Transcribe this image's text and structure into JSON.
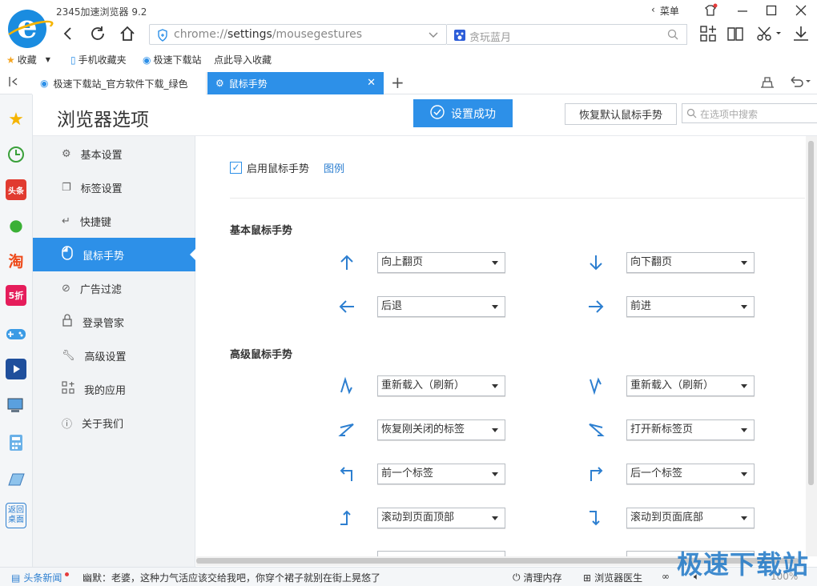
{
  "window": {
    "title": "2345加速浏览器 9.2",
    "menu_label": "菜单"
  },
  "address": {
    "prefix": "chrome://",
    "host": "settings",
    "path": "/mousegestures"
  },
  "search": {
    "placeholder": "贪玩蓝月"
  },
  "bookmarks": [
    "收藏",
    "手机收藏夹",
    "极速下载站",
    "点此导入收藏"
  ],
  "tabs": [
    {
      "label": "极速下载站_官方软件下载_绿色"
    },
    {
      "label": "鼠标手势"
    }
  ],
  "sidebar_icons": [
    "star-icon",
    "clock-icon",
    "toutiao-icon",
    "wechat-icon",
    "taobao-icon",
    "discount-icon",
    "game-icon",
    "video-icon",
    "computer-icon",
    "calculator-icon",
    "notepad-icon",
    "desktop-icon"
  ],
  "sidebar_labels": {
    "toutiao": "头条",
    "taobao": "淘",
    "discount": "5折",
    "desktop": "返回桌面"
  },
  "settings": {
    "title": "浏览器选项",
    "success_label": "设置成功",
    "restore_label": "恢复默认鼠标手势",
    "search_placeholder": "在选项中搜索"
  },
  "menu": [
    {
      "label": "基本设置",
      "icon": "gear-icon"
    },
    {
      "label": "标签设置",
      "icon": "tab-icon"
    },
    {
      "label": "快捷键",
      "icon": "shortcut-icon"
    },
    {
      "label": "鼠标手势",
      "icon": "mouse-icon",
      "active": true
    },
    {
      "label": "广告过滤",
      "icon": "block-icon"
    },
    {
      "label": "登录管家",
      "icon": "lock-icon"
    },
    {
      "label": "高级设置",
      "icon": "wrench-icon"
    },
    {
      "label": "我的应用",
      "icon": "apps-icon"
    },
    {
      "label": "关于我们",
      "icon": "info-icon"
    }
  ],
  "gestures": {
    "enable_label": "启用鼠标手势",
    "enable_checked": true,
    "legend_link": "图例",
    "basic_title": "基本鼠标手势",
    "advanced_title": "高级鼠标手势",
    "basic": [
      {
        "arrow": "up-arrow-icon",
        "action": "向上翻页"
      },
      {
        "arrow": "down-arrow-icon",
        "action": "向下翻页"
      },
      {
        "arrow": "left-arrow-icon",
        "action": "后退"
      },
      {
        "arrow": "right-arrow-icon",
        "action": "前进"
      }
    ],
    "advanced": [
      {
        "arrow": "up-down-gesture-icon",
        "action": "重新载入（刷新）"
      },
      {
        "arrow": "down-up-gesture-icon",
        "action": "重新载入（刷新）"
      },
      {
        "arrow": "right-left-gesture-icon",
        "action": "恢复刚关闭的标签"
      },
      {
        "arrow": "left-right-gesture-icon",
        "action": "打开新标签页"
      },
      {
        "arrow": "up-left-gesture-icon",
        "action": "前一个标签"
      },
      {
        "arrow": "up-right-gesture-icon",
        "action": "后一个标签"
      },
      {
        "arrow": "right-up-gesture-icon",
        "action": "滚动到页面顶部"
      },
      {
        "arrow": "right-down-gesture-icon",
        "action": "滚动到页面底部"
      }
    ]
  },
  "status": {
    "news_label": "头条新闻",
    "news_text": "幽默：老婆，这种力气活应该交给我吧，你穿个裙子就别在街上晃悠了",
    "clean_memory": "清理内存",
    "doctor": "浏览器医生",
    "zoom": "100%"
  },
  "watermark": "极速下载站",
  "colors": {
    "accent": "#2d90e8",
    "menu_bg": "#f1f3f5"
  }
}
